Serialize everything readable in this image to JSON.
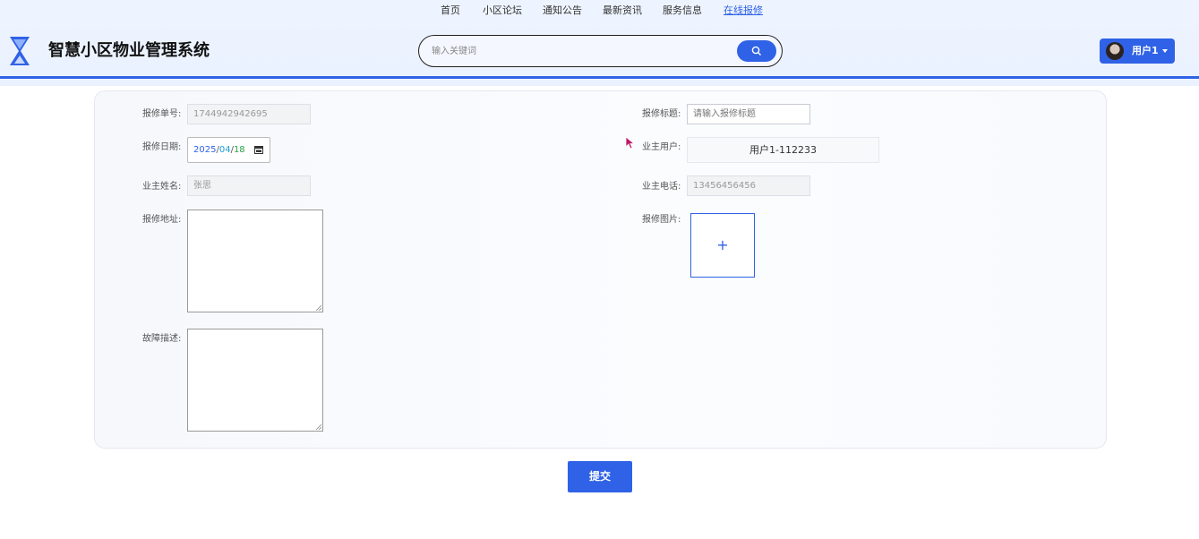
{
  "nav": {
    "items": [
      {
        "label": "首页"
      },
      {
        "label": "小区论坛"
      },
      {
        "label": "通知公告"
      },
      {
        "label": "最新资讯"
      },
      {
        "label": "服务信息"
      },
      {
        "label": "在线报修"
      }
    ],
    "active": "在线报修"
  },
  "brand": {
    "title": "智慧小区物业管理系统",
    "logo_icon": "hourglass-icon"
  },
  "search": {
    "placeholder": "输入关键词",
    "icon": "search-icon"
  },
  "user": {
    "name": "用户1",
    "avatar_icon": "avatar-icon",
    "caret_icon": "caret-down-icon"
  },
  "colors": {
    "accent": "#2f62e6",
    "header_bg": "#eef4ff"
  },
  "form": {
    "repair_no": {
      "label": "报修单号:",
      "value": "1744942942695"
    },
    "repair_title": {
      "label": "报修标题:",
      "placeholder": "请输入报修标题"
    },
    "repair_date": {
      "label": "报修日期:",
      "year": "2025",
      "month": "04",
      "day": "18",
      "separator": "/"
    },
    "owner_user": {
      "label": "业主用户:",
      "value": "用户1-112233"
    },
    "owner_name": {
      "label": "业主姓名:",
      "value": "张思"
    },
    "owner_phone": {
      "label": "业主电话:",
      "value": "13456456456"
    },
    "repair_address": {
      "label": "报修地址:",
      "value": ""
    },
    "repair_image": {
      "label": "报修图片:",
      "upload_symbol": "+"
    },
    "fault_desc": {
      "label": "故障描述:",
      "value": ""
    }
  },
  "submit": {
    "label": "提交"
  }
}
